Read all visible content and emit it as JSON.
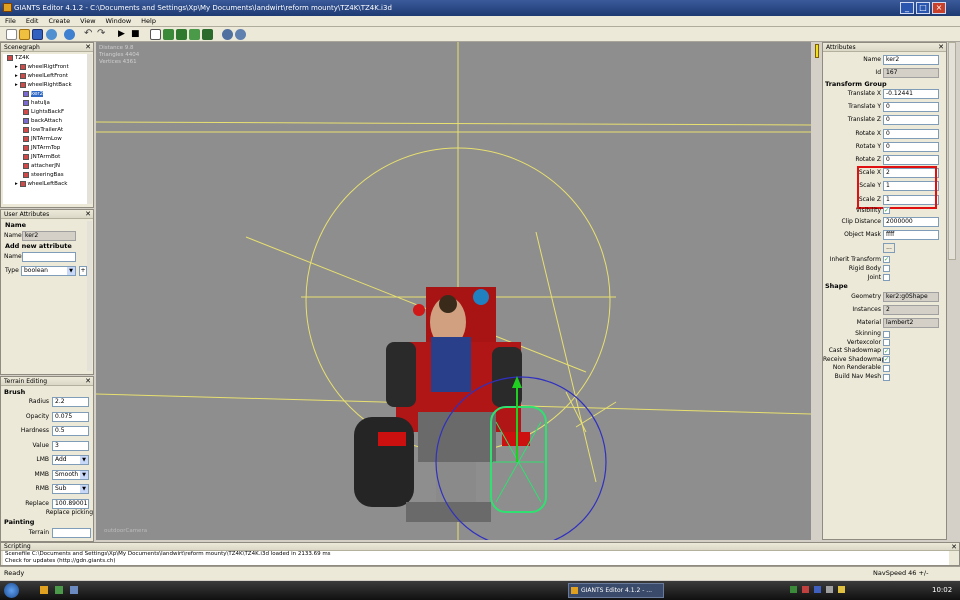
{
  "window": {
    "title": "GIANTS Editor 4.1.2 - C:\\Documents and Settings\\Xp\\My Documents\\landwirt\\reform mounty\\TZ4K\\TZ4K.i3d"
  },
  "menu": [
    "File",
    "Edit",
    "Create",
    "View",
    "Window",
    "Help"
  ],
  "scenegraph": {
    "title": "Scenegraph",
    "items": [
      {
        "label": "TZ4K",
        "depth": 0,
        "icon": "transform-group-icon"
      },
      {
        "label": "wheelRigtFront",
        "depth": 1,
        "icon": "transform-group-icon"
      },
      {
        "label": "wheelLeftFront",
        "depth": 1,
        "icon": "transform-group-icon"
      },
      {
        "label": "wheelRightBack",
        "depth": 1,
        "icon": "transform-group-icon"
      },
      {
        "label": "ker2",
        "depth": 2,
        "icon": "shape-icon"
      },
      {
        "label": "hatulja",
        "depth": 2,
        "icon": "shape-icon"
      },
      {
        "label": "LightsBackF",
        "depth": 2,
        "icon": "transform-group-icon"
      },
      {
        "label": "backAttach",
        "depth": 2,
        "icon": "shape-icon"
      },
      {
        "label": "lowTrailerAt",
        "depth": 2,
        "icon": "transform-group-icon"
      },
      {
        "label": "JNTArmLow",
        "depth": 2,
        "icon": "transform-group-icon"
      },
      {
        "label": "JNTArmTop",
        "depth": 2,
        "icon": "transform-group-icon"
      },
      {
        "label": "JNTArmBot",
        "depth": 2,
        "icon": "transform-group-icon"
      },
      {
        "label": "attacherJN",
        "depth": 2,
        "icon": "transform-group-icon"
      },
      {
        "label": "steeringBas",
        "depth": 2,
        "icon": "transform-group-icon"
      },
      {
        "label": "wheelLeftBack",
        "depth": 1,
        "icon": "transform-group-icon"
      }
    ]
  },
  "user_attributes": {
    "title": "User Attributes",
    "name_section": "Name",
    "name_label": "Name",
    "name_value": "ker2",
    "add_section": "Add new attribute",
    "new_name_label": "Name",
    "type_label": "Type",
    "type_value": "boolean",
    "plus_label": "+"
  },
  "terrain": {
    "title": "Terrain Editing",
    "brush_section": "Brush",
    "fields": [
      {
        "label": "Radius",
        "value": "2.2",
        "kind": "text"
      },
      {
        "label": "Opacity",
        "value": "0.075",
        "kind": "text"
      },
      {
        "label": "Hardness",
        "value": "0.5",
        "kind": "text"
      },
      {
        "label": "Value",
        "value": "3",
        "kind": "text"
      },
      {
        "label": "LMB",
        "value": "Add",
        "kind": "select"
      },
      {
        "label": "MMB",
        "value": "Smooth",
        "kind": "select"
      },
      {
        "label": "RMB",
        "value": "Sub",
        "kind": "select"
      },
      {
        "label": "Replace",
        "value": "100.89001",
        "kind": "text"
      }
    ],
    "replace_picking": "Replace picking",
    "painting_section": "Painting",
    "terrain_label": "Terrain"
  },
  "viewport": {
    "stats": [
      "Distance 9.8",
      "Triangles 4404",
      "Vertices 4361"
    ],
    "camera_label": "outdoorCamera"
  },
  "attributes": {
    "title": "Attributes",
    "name_label": "Name",
    "name_value": "ker2",
    "id_label": "Id",
    "id_value": "167",
    "transform_section": "Transform Group",
    "transform": [
      {
        "label": "Translate X",
        "value": "-0.12441"
      },
      {
        "label": "Translate Y",
        "value": "0"
      },
      {
        "label": "Translate Z",
        "value": "0"
      },
      {
        "label": "Rotate X",
        "value": "0"
      },
      {
        "label": "Rotate Y",
        "value": "0"
      },
      {
        "label": "Rotate Z",
        "value": "0"
      },
      {
        "label": "Scale X",
        "value": "2"
      },
      {
        "label": "Scale Y",
        "value": "1"
      },
      {
        "label": "Scale Z",
        "value": "1"
      }
    ],
    "visibility_label": "Visibility",
    "visibility_checked": true,
    "clip_label": "Clip Distance",
    "clip_value": "2000000",
    "mask_label": "Object Mask",
    "mask_value": "ffff",
    "dots_label": "...",
    "inherit_label": "Inherit Transform",
    "rigid_label": "Rigid Body",
    "joint_label": "Joint",
    "shape_section": "Shape",
    "geometry_label": "Geometry",
    "geometry_value": "ker2:g0Shape",
    "instances_label": "Instances",
    "instances_value": "2",
    "material_label": "Material",
    "material_value": "lambert2",
    "flags": [
      {
        "label": "Skinning",
        "checked": false
      },
      {
        "label": "Vertexcolor",
        "checked": false
      },
      {
        "label": "Cast Shadowmap",
        "checked": true
      },
      {
        "label": "Receive Shadowmap",
        "checked": true
      },
      {
        "label": "Non Renderable",
        "checked": false
      },
      {
        "label": "Build Nav Mesh",
        "checked": false
      }
    ]
  },
  "scripting": {
    "title": "Scripting",
    "line1": "Scenefile C:\\Documents and Settings\\Xp\\My Documents\\landwirt\\reform mounty\\TZ4K\\TZ4K.i3d loaded in 2133.69 ms",
    "line2": "Check for updates (http://gdn.giants.ch)"
  },
  "status": {
    "left": "Ready",
    "right": "NavSpeed 46 +/-"
  },
  "taskbar": {
    "task_label": "GIANTS Editor 4.1.2 - ...",
    "clock": "10:02"
  },
  "colors": {
    "highlight": "#e01010",
    "viewport_bg": "#8e8e8e",
    "tractor_red": "#c01818",
    "wheel_select": "#30e070"
  }
}
